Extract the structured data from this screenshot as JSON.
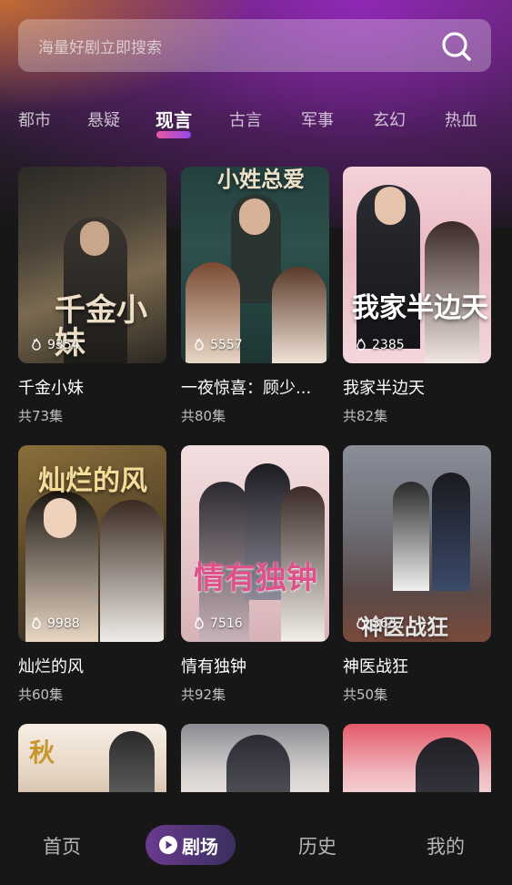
{
  "search": {
    "placeholder": "海量好剧立即搜索",
    "icon": "search-icon"
  },
  "categories": [
    {
      "label": "都市",
      "active": false
    },
    {
      "label": "悬疑",
      "active": false
    },
    {
      "label": "现言",
      "active": true
    },
    {
      "label": "古言",
      "active": false
    },
    {
      "label": "军事",
      "active": false
    },
    {
      "label": "玄幻",
      "active": false
    },
    {
      "label": "热血",
      "active": false
    }
  ],
  "dramas": [
    {
      "title": "千金小妹",
      "episodes": "共73集",
      "views": "9354",
      "poster_text": "千金小妹"
    },
    {
      "title": "一夜惊喜：顾少...",
      "episodes": "共80集",
      "views": "5557",
      "poster_text": "小姓总爱"
    },
    {
      "title": "我家半边天",
      "episodes": "共82集",
      "views": "2385",
      "poster_text": "我家半边天"
    },
    {
      "title": "灿烂的风",
      "episodes": "共60集",
      "views": "9988",
      "poster_text": "灿烂的风"
    },
    {
      "title": "情有独钟",
      "episodes": "共92集",
      "views": "7516",
      "poster_text": "情有独钟"
    },
    {
      "title": "神医战狂",
      "episodes": "共50集",
      "views": "5637",
      "poster_text": "神医战狂"
    }
  ],
  "partial_posters": [
    {
      "poster_text": "秋"
    },
    {
      "poster_text": ""
    },
    {
      "poster_text": ""
    }
  ],
  "tabbar": {
    "home": "首页",
    "theater": "剧场",
    "history": "历史",
    "mine": "我的"
  },
  "colors": {
    "background": "#171717",
    "accent_pink": "#ff5fa8",
    "accent_purple": "#9b4dff"
  }
}
